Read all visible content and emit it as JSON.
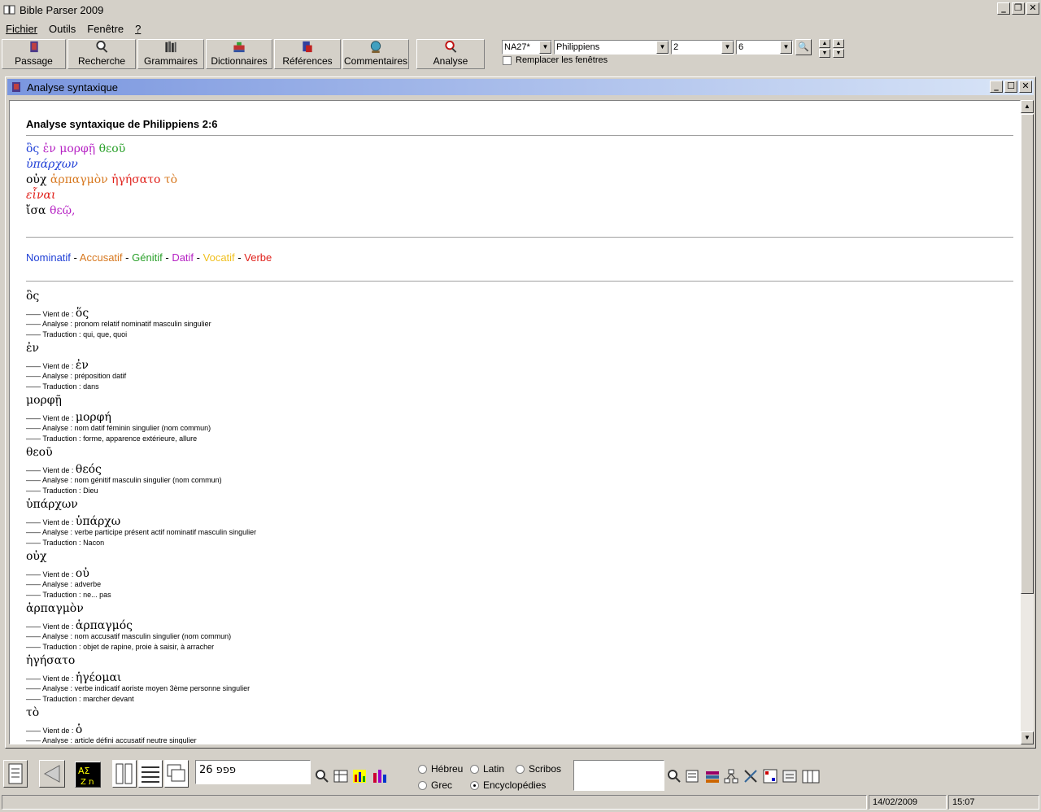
{
  "window": {
    "title": "Bible Parser 2009"
  },
  "menu": [
    {
      "label": "Fichier"
    },
    {
      "label": "Outils"
    },
    {
      "label": "Fenêtre"
    },
    {
      "label": "?"
    }
  ],
  "toolbar": {
    "buttons": [
      {
        "label": "Passage"
      },
      {
        "label": "Recherche"
      },
      {
        "label": "Grammaires"
      },
      {
        "label": "Dictionnaires"
      },
      {
        "label": "Références"
      },
      {
        "label": "Commentaires"
      },
      {
        "label": "Analyse"
      }
    ],
    "version": "NA27*",
    "book": "Philippiens",
    "chapter": "2",
    "verse": "6",
    "replace_windows": "Remplacer les fenêtres"
  },
  "child": {
    "title": "Analyse syntaxique",
    "heading": "Analyse syntaxique de Philippiens 2:6",
    "legend": [
      {
        "label": "Nominatif",
        "color": "#1f3fd6"
      },
      {
        "label": "Accusatif",
        "color": "#d7781f"
      },
      {
        "label": "Génitif",
        "color": "#2aa02a"
      },
      {
        "label": "Datif",
        "color": "#b623c4"
      },
      {
        "label": "Vocatif",
        "color": "#f0c020"
      },
      {
        "label": "Verbe",
        "color": "#e0201a"
      }
    ],
    "labels": {
      "from": "Vient de :",
      "analysis": "Analyse :",
      "translation": "Traduction :"
    },
    "words": [
      {
        "form": "ὃς",
        "lemma": "ὅς",
        "analysis": "pronom relatif nominatif masculin singulier",
        "translation": "qui, que, quoi"
      },
      {
        "form": "ἐν",
        "lemma": "ἐν",
        "analysis": "préposition datif",
        "translation": "dans"
      },
      {
        "form": "μορφῇ",
        "lemma": "μορφή",
        "analysis": "nom datif féminin singulier (nom commun)",
        "translation": "forme, apparence extérieure, allure"
      },
      {
        "form": "θεοῦ",
        "lemma": "θεός",
        "analysis": "nom génitif masculin singulier (nom commun)",
        "translation": "Dieu"
      },
      {
        "form": "ὑπάρχων",
        "lemma": "ὑπάρχω",
        "analysis": "verbe participe présent actif nominatif masculin singulier",
        "translation": "Nacon"
      },
      {
        "form": "οὐχ",
        "lemma": "οὐ",
        "analysis": "adverbe",
        "translation": "ne... pas"
      },
      {
        "form": "ἁρπαγμὸν",
        "lemma": "ἁρπαγμός",
        "analysis": "nom accusatif masculin singulier (nom commun)",
        "translation": "objet de rapine, proie à saisir, à arracher"
      },
      {
        "form": "ἡγήσατο",
        "lemma": "ἡγέομαι",
        "analysis": "verbe indicatif aoriste moyen 3ème personne singulier",
        "translation": "marcher devant"
      },
      {
        "form": "τὸ",
        "lemma": "ὁ",
        "analysis": "article défini accusatif neutre singulier",
        "translation": ""
      }
    ]
  },
  "bottom": {
    "ref_field": "פפפ 26",
    "radios": [
      {
        "label": "Hébreu",
        "checked": false
      },
      {
        "label": "Latin",
        "checked": false
      },
      {
        "label": "Scribos",
        "checked": false
      },
      {
        "label": "Grec",
        "checked": false
      },
      {
        "label": "Encyclopédies",
        "checked": true
      }
    ]
  },
  "status": {
    "date": "14/02/2009",
    "time": "15:07"
  }
}
